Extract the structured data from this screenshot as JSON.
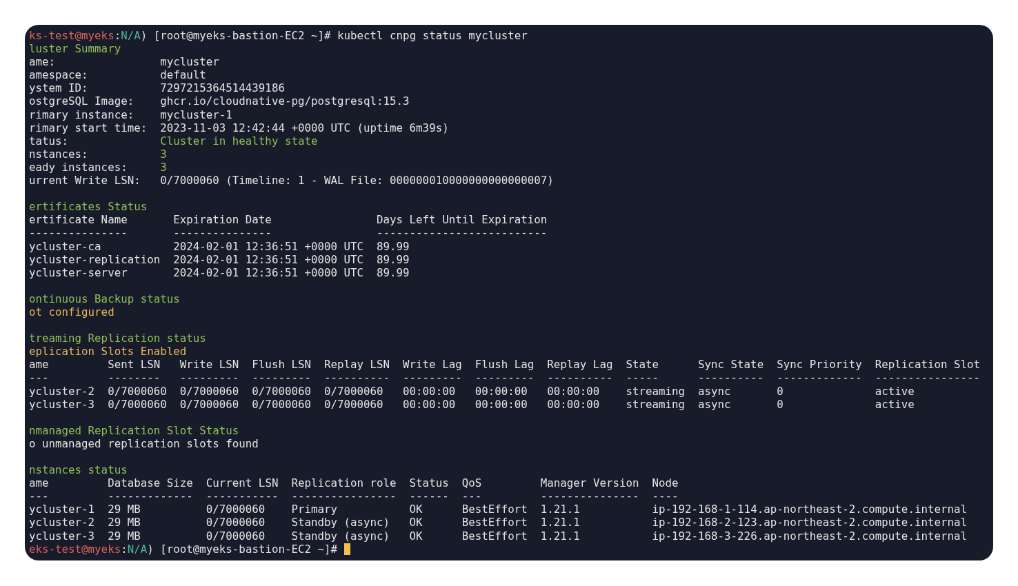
{
  "command_prompt": {
    "segments": [
      {
        "text": "ks-test@myeks",
        "kind": "user"
      },
      {
        "text": ":",
        "kind": "plain"
      },
      {
        "text": "N/A",
        "kind": "context"
      },
      {
        "text": ") [root@myeks-bastion-EC2 ~]# kubectl cnpg status mycluster",
        "kind": "plain"
      }
    ]
  },
  "sections": [
    {
      "kind": "summary",
      "title": "luster Summary",
      "fields": [
        {
          "label": "ame:",
          "value": "mycluster",
          "highlighted": false
        },
        {
          "label": "amespace:",
          "value": "default",
          "highlighted": false
        },
        {
          "label": "ystem ID:",
          "value": "7297215364514439186",
          "highlighted": false
        },
        {
          "label": "ostgreSQL Image:",
          "value": "ghcr.io/cloudnative-pg/postgresql:15.3",
          "highlighted": false
        },
        {
          "label": "rimary instance:",
          "value": "mycluster-1",
          "highlighted": false
        },
        {
          "label": "rimary start time:",
          "value": "2023-11-03 12:42:44 +0000 UTC (uptime 6m39s)",
          "highlighted": false
        },
        {
          "label": "tatus:",
          "value": "Cluster in healthy state",
          "highlighted": true
        },
        {
          "label": "nstances:",
          "value": "3",
          "highlighted": true
        },
        {
          "label": "eady instances:",
          "value": "3",
          "highlighted": true
        },
        {
          "label": "urrent Write LSN:",
          "value": "0/7000060 (Timeline: 1 - WAL File: 000000010000000000000007)",
          "highlighted": false
        }
      ]
    },
    {
      "kind": "table",
      "title": "ertificates Status",
      "columns": [
        "ertificate Name",
        "Expiration Date",
        "Days Left Until Expiration"
      ],
      "rules": [
        "---------------",
        "---------------",
        "--------------------------"
      ],
      "rows": [
        [
          "ycluster-ca",
          "2024-02-01 12:36:51 +0000 UTC",
          "89.99"
        ],
        [
          "ycluster-replication",
          "2024-02-01 12:36:51 +0000 UTC",
          "89.99"
        ],
        [
          "ycluster-server",
          "2024-02-01 12:36:51 +0000 UTC",
          "89.99"
        ]
      ]
    },
    {
      "kind": "message",
      "title": "ontinuous Backup status",
      "lines": [
        {
          "text": "ot configured",
          "kind": "warning"
        }
      ]
    },
    {
      "kind": "table",
      "title": "treaming Replication status",
      "note": {
        "text": "eplication Slots Enabled",
        "kind": "warning"
      },
      "columns": [
        "ame",
        "Sent LSN",
        "Write LSN",
        "Flush LSN",
        "Replay LSN",
        "Write Lag",
        "Flush Lag",
        "Replay Lag",
        "State",
        "Sync State",
        "Sync Priority",
        "Replication Slot"
      ],
      "rules": [
        "---",
        "--------",
        "---------",
        "---------",
        "----------",
        "---------",
        "---------",
        "----------",
        "-----",
        "----------",
        "-------------",
        "----------------"
      ],
      "rows": [
        [
          "ycluster-2",
          "0/7000060",
          "0/7000060",
          "0/7000060",
          "0/7000060",
          "00:00:00",
          "00:00:00",
          "00:00:00",
          "streaming",
          "async",
          "0",
          "active"
        ],
        [
          "ycluster-3",
          "0/7000060",
          "0/7000060",
          "0/7000060",
          "0/7000060",
          "00:00:00",
          "00:00:00",
          "00:00:00",
          "streaming",
          "async",
          "0",
          "active"
        ]
      ]
    },
    {
      "kind": "message",
      "title": "nmanaged Replication Slot Status",
      "lines": [
        {
          "text": "o unmanaged replication slots found",
          "kind": "info"
        }
      ]
    },
    {
      "kind": "table",
      "title": "nstances status",
      "columns": [
        "ame",
        "Database Size",
        "Current LSN",
        "Replication role",
        "Status",
        "QoS",
        "Manager Version",
        "Node"
      ],
      "rules": [
        "---",
        "-------------",
        "-----------",
        "----------------",
        "------",
        "---",
        "---------------",
        "----"
      ],
      "rows": [
        [
          "ycluster-1",
          "29 MB",
          "0/7000060",
          "Primary",
          "OK",
          "BestEffort",
          "1.21.1",
          "ip-192-168-1-114.ap-northeast-2.compute.internal"
        ],
        [
          "ycluster-2",
          "29 MB",
          "0/7000060",
          "Standby (async)",
          "OK",
          "BestEffort",
          "1.21.1",
          "ip-192-168-2-123.ap-northeast-2.compute.internal"
        ],
        [
          "ycluster-3",
          "29 MB",
          "0/7000060",
          "Standby (async)",
          "OK",
          "BestEffort",
          "1.21.1",
          "ip-192-168-3-226.ap-northeast-2.compute.internal"
        ]
      ]
    }
  ],
  "shell_prompt": {
    "segments": [
      {
        "text": "eks-test@myeks",
        "kind": "user"
      },
      {
        "text": ":",
        "kind": "plain"
      },
      {
        "text": "N/A",
        "kind": "context"
      },
      {
        "text": ") [root@myeks-bastion-EC2 ~]#",
        "kind": "plain"
      }
    ],
    "cursor": true
  }
}
